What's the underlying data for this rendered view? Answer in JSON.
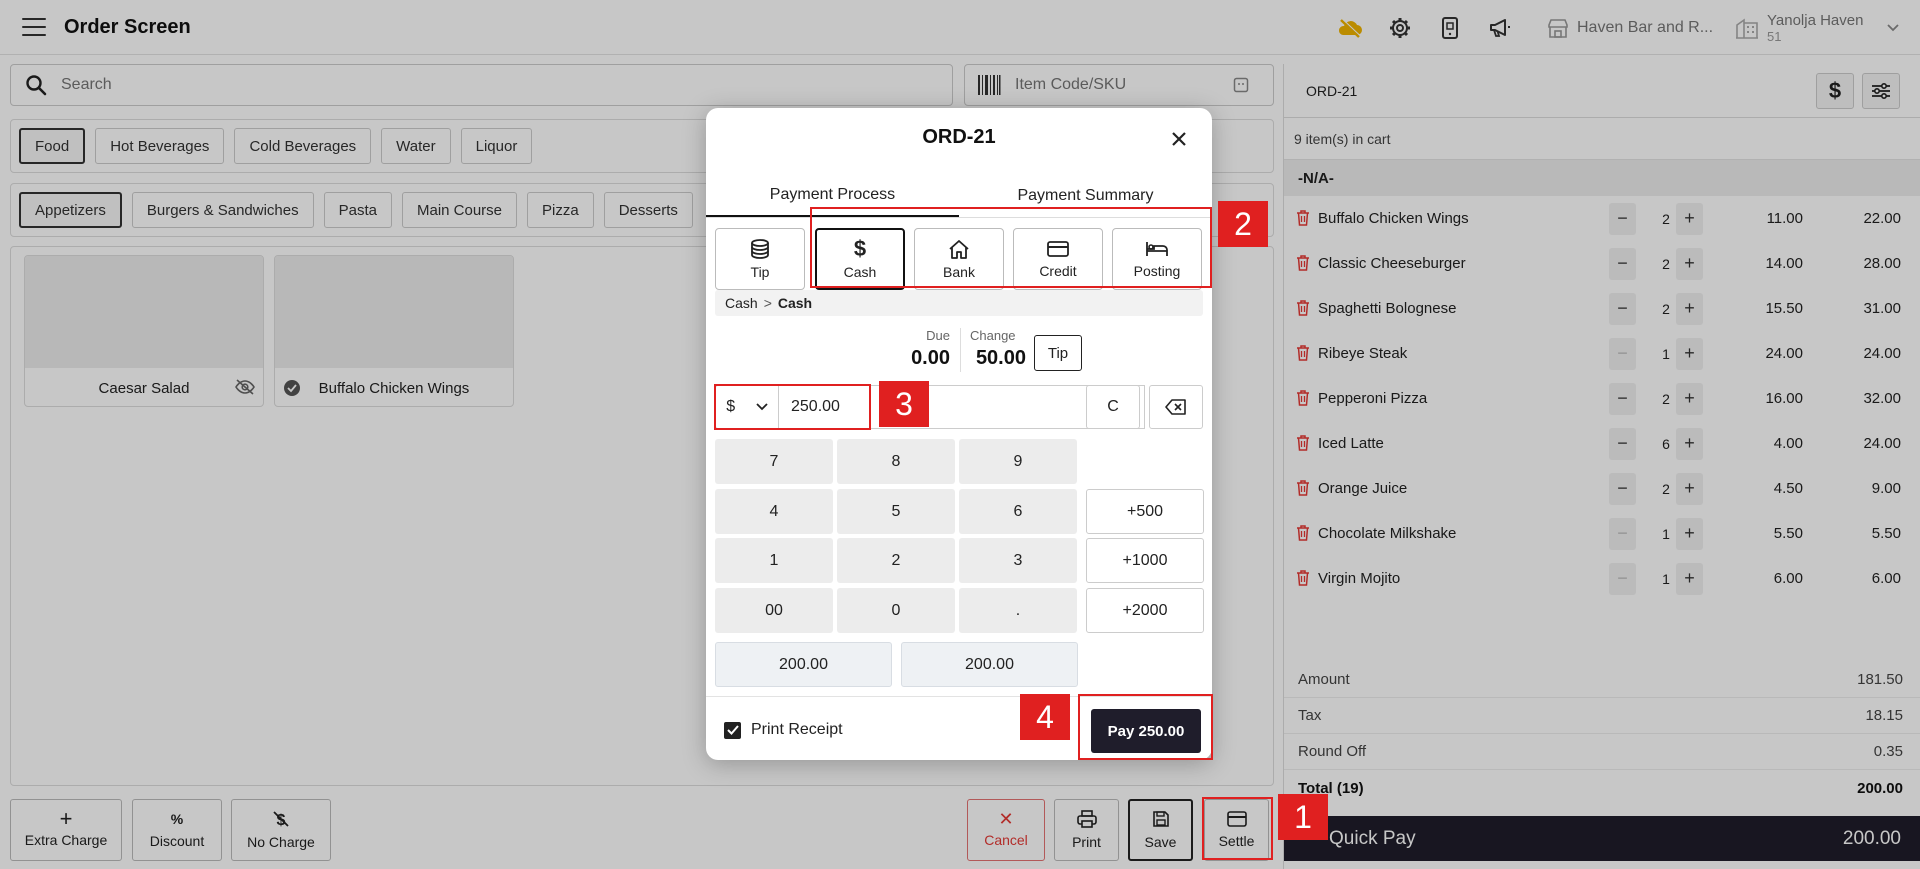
{
  "app": {
    "title": "Order Screen",
    "store": "Haven Bar and R...",
    "user_name": "Yanolja Haven",
    "user_sub": "51"
  },
  "search": {
    "placeholder": "Search"
  },
  "sku": {
    "placeholder": "Item Code/SKU"
  },
  "categories": [
    "Food",
    "Hot Beverages",
    "Cold Beverages",
    "Water",
    "Liquor"
  ],
  "subcategories": [
    "Appetizers",
    "Burgers & Sandwiches",
    "Pasta",
    "Main Course",
    "Pizza",
    "Desserts"
  ],
  "products": [
    "Caesar Salad",
    "Buffalo Chicken Wings"
  ],
  "actions": {
    "extra_charge": "Extra Charge",
    "discount": "Discount",
    "discount_symbol": "%",
    "no_charge": "No Charge",
    "cancel": "Cancel",
    "print": "Print",
    "save": "Save",
    "settle": "Settle"
  },
  "cart": {
    "order_id": "ORD-21",
    "count_label": "9 item(s) in cart",
    "group": "-N/A-",
    "items": [
      {
        "name": "Buffalo Chicken Wings",
        "qty": "2",
        "price": "11.00",
        "total": "22.00"
      },
      {
        "name": "Classic Cheeseburger",
        "qty": "2",
        "price": "14.00",
        "total": "28.00"
      },
      {
        "name": "Spaghetti Bolognese",
        "qty": "2",
        "price": "15.50",
        "total": "31.00"
      },
      {
        "name": "Ribeye Steak",
        "qty": "1",
        "price": "24.00",
        "total": "24.00"
      },
      {
        "name": "Pepperoni Pizza",
        "qty": "2",
        "price": "16.00",
        "total": "32.00"
      },
      {
        "name": "Iced Latte",
        "qty": "6",
        "price": "4.00",
        "total": "24.00"
      },
      {
        "name": "Orange Juice",
        "qty": "2",
        "price": "4.50",
        "total": "9.00"
      },
      {
        "name": "Chocolate Milkshake",
        "qty": "1",
        "price": "5.50",
        "total": "5.50"
      },
      {
        "name": "Virgin Mojito",
        "qty": "1",
        "price": "6.00",
        "total": "6.00"
      }
    ],
    "summary": {
      "amount_label": "Amount",
      "amount": "181.50",
      "tax_label": "Tax",
      "tax": "18.15",
      "round_label": "Round Off",
      "round": "0.35",
      "total_label": "Total (19)",
      "total": "200.00"
    },
    "quick_pay_label": "Quick Pay",
    "quick_pay_amount": "200.00"
  },
  "modal": {
    "title": "ORD-21",
    "tabs": [
      "Payment Process",
      "Payment Summary"
    ],
    "methods": [
      "Tip",
      "Cash",
      "Bank",
      "Credit",
      "Posting"
    ],
    "breadcrumb_parent": "Cash",
    "breadcrumb_sep": ">",
    "breadcrumb_current": "Cash",
    "due_label": "Due",
    "due": "0.00",
    "change_label": "Change",
    "change": "50.00",
    "tip_button": "Tip",
    "currency": "$",
    "amount": "250.00",
    "clear": "C",
    "keys": [
      "7",
      "8",
      "9",
      "4",
      "5",
      "6",
      "1",
      "2",
      "3",
      "00",
      "0",
      "."
    ],
    "quick_add": [
      "+500",
      "+1000",
      "+2000"
    ],
    "presets": [
      "200.00",
      "200.00"
    ],
    "print_receipt": "Print Receipt",
    "pay_button": "Pay 250.00"
  },
  "annotations": [
    "1",
    "2",
    "3",
    "4"
  ],
  "colors": {
    "highlight": "#e02020",
    "dark": "#1f1d2b",
    "cancel": "#e53935"
  }
}
